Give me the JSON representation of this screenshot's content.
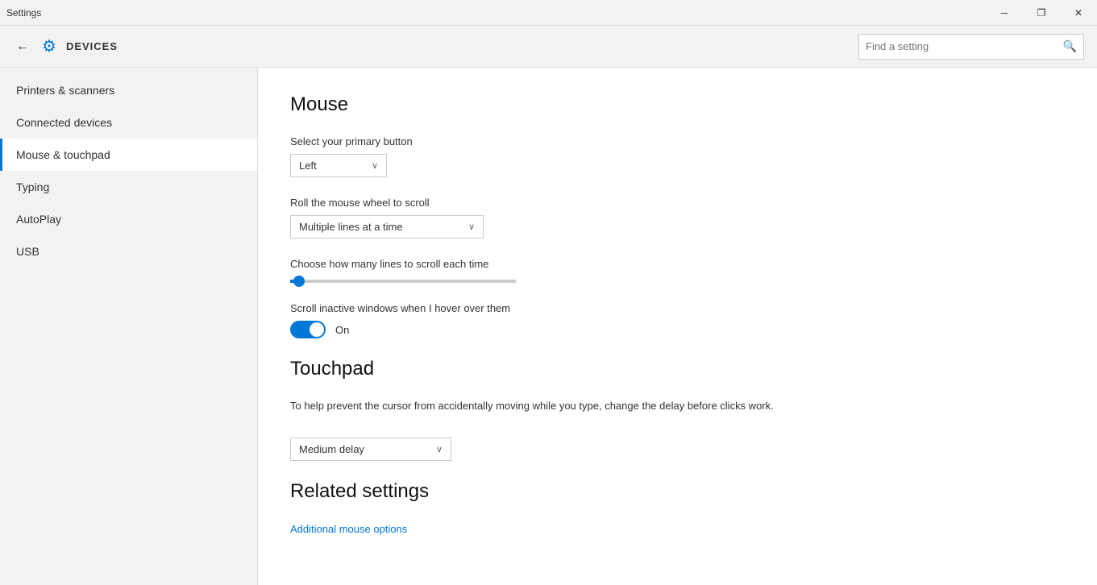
{
  "titlebar": {
    "title": "Settings",
    "minimize_label": "─",
    "restore_label": "❐",
    "close_label": "✕"
  },
  "header": {
    "app_title": "DEVICES",
    "search_placeholder": "Find a setting",
    "gear_icon": "⚙"
  },
  "sidebar": {
    "items": [
      {
        "id": "printers",
        "label": "Printers & scanners",
        "active": false
      },
      {
        "id": "connected",
        "label": "Connected devices",
        "active": false
      },
      {
        "id": "mouse",
        "label": "Mouse & touchpad",
        "active": true
      },
      {
        "id": "typing",
        "label": "Typing",
        "active": false
      },
      {
        "id": "autoplay",
        "label": "AutoPlay",
        "active": false
      },
      {
        "id": "usb",
        "label": "USB",
        "active": false
      }
    ]
  },
  "main": {
    "mouse_section": {
      "title": "Mouse",
      "primary_button_label": "Select your primary button",
      "primary_button_value": "Left",
      "scroll_label": "Roll the mouse wheel to scroll",
      "scroll_value": "Multiple lines at a time",
      "scroll_lines_label": "Choose how many lines to scroll each time",
      "inactive_scroll_label": "Scroll inactive windows when I hover over them",
      "toggle_state": "On"
    },
    "touchpad_section": {
      "title": "Touchpad",
      "description": "To help prevent the cursor from accidentally moving while you type, change the delay before clicks work.",
      "delay_value": "Medium delay"
    },
    "related_settings": {
      "title": "Related settings",
      "link_label": "Additional mouse options"
    }
  },
  "icons": {
    "chevron_down": "∨",
    "search": "🔍",
    "back": "←"
  }
}
